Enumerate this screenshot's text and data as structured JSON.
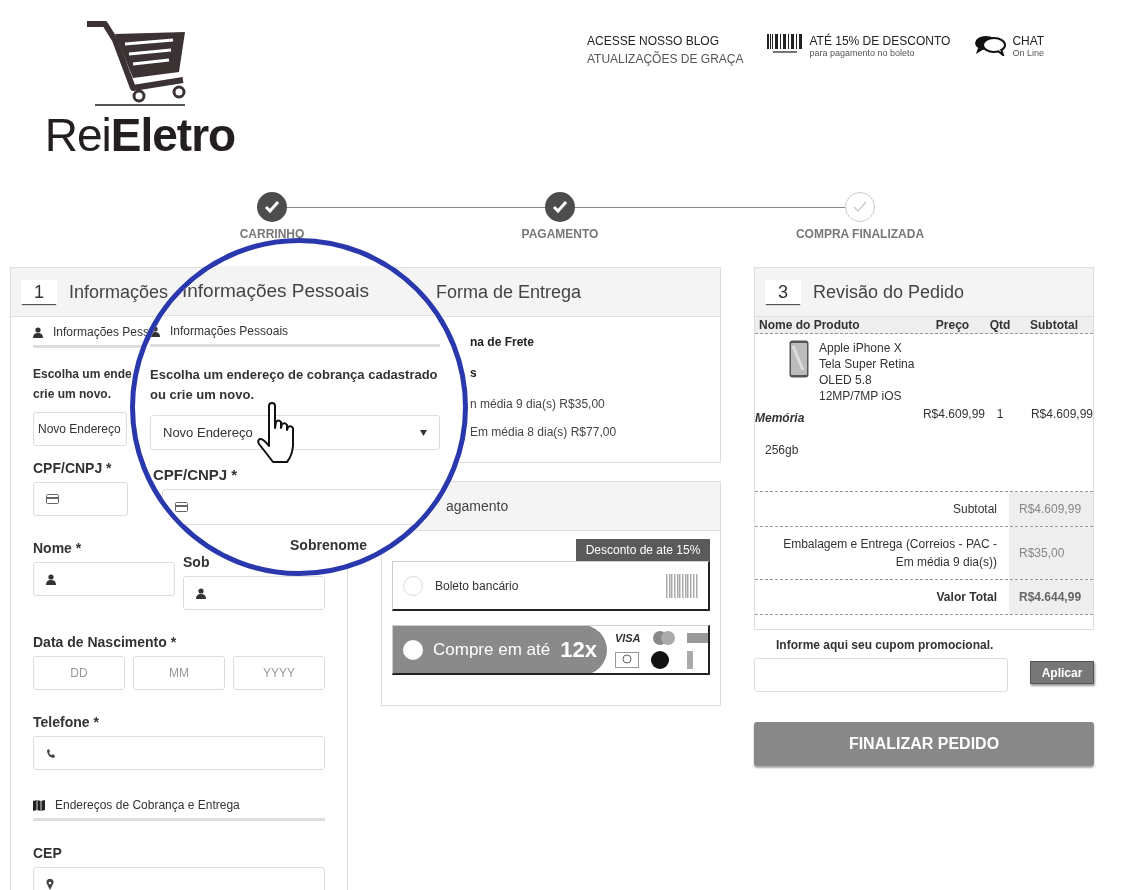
{
  "header": {
    "logo": "Rei**Eletro**",
    "links": [
      {
        "kind": "blog",
        "title": "ACESSE NOSSO BLOG",
        "subtitle": "ATUALIZAÇÕES DE GRAÇA"
      },
      {
        "kind": "boleto",
        "title": "ATÉ 15% DE DESCONTO",
        "subtitle": "para pagamento no boleto"
      },
      {
        "kind": "chat",
        "title": "CHAT",
        "subtitle": "On Line"
      }
    ]
  },
  "steps": [
    {
      "label": "CARRINHO",
      "done": true
    },
    {
      "label": "PAGAMENTO",
      "done": true
    },
    {
      "label": "COMPRA FINALIZADA",
      "done": false
    }
  ],
  "personal": {
    "number": "1",
    "title": "Informações",
    "section": "Informações Pess",
    "prompt_lines": [
      "Escolha um ende",
      "crie um novo."
    ],
    "address_select": "Novo Endereço",
    "cpf_label": "CPF/CNPJ *",
    "name_label": "Nome *",
    "surname_label": "Sob",
    "birth_label": "Data de Nascimento *",
    "date_placeholders": [
      "DD",
      "MM",
      "YYYY"
    ],
    "phone_label": "Telefone *",
    "address_section": "Endereços de Cobrança e Entrega",
    "cep_label": "CEP"
  },
  "delivery": {
    "title": "Forma de Entrega",
    "lines": [
      {
        "text": "na de Frete",
        "bold": true
      },
      {
        "text": "s",
        "bold": true
      },
      {
        "text": "n média 9 dia(s) R$35,00",
        "bold": false
      },
      {
        "text": "Em média 8 dia(s) R$77,00",
        "bold": false
      }
    ]
  },
  "payment": {
    "title": "agamento",
    "badge": "Desconto de ate 15%",
    "options": [
      {
        "kind": "boleto",
        "label": "Boleto bancário",
        "selected": false
      },
      {
        "kind": "card",
        "label": "Compre em até",
        "installments": "12x",
        "brand": "VISA",
        "selected": false
      }
    ]
  },
  "review": {
    "number": "3",
    "title": "Revisão do Pedido",
    "columns": [
      "Nome do Produto",
      "Preço",
      "Qtd",
      "Subtotal"
    ],
    "item": {
      "name": "Apple iPhone X Tela Super Retina OLED 5.8 12MP/7MP iOS",
      "option_label": "Memória",
      "option_value": "256gb",
      "price": "R$4.609,99",
      "qty": "1",
      "subtotal": "R$4.609,99"
    },
    "totals": [
      {
        "label": "Subtotal",
        "value": "R$4.609,99"
      },
      {
        "label": "Embalagem e Entrega (Correios - PAC - Em média 9 dia(s))",
        "value": "R$35,00"
      },
      {
        "label": "Valor Total",
        "value": "R$4.644,99"
      }
    ],
    "coupon_label": "Informe aqui seu cupom promocional.",
    "apply_button": "Aplicar",
    "finish_button": "FINALIZAR PEDIDO"
  },
  "magnifier": {
    "title": "Informações Pessoais",
    "section": "Informações Pessoais",
    "prompt": "Escolha um endereço de cobrança cadastrado ou crie um novo.",
    "address_select": "Novo Endereço",
    "cpf_label": "CPF/CNPJ *",
    "surname_label": "Sobrenome"
  }
}
